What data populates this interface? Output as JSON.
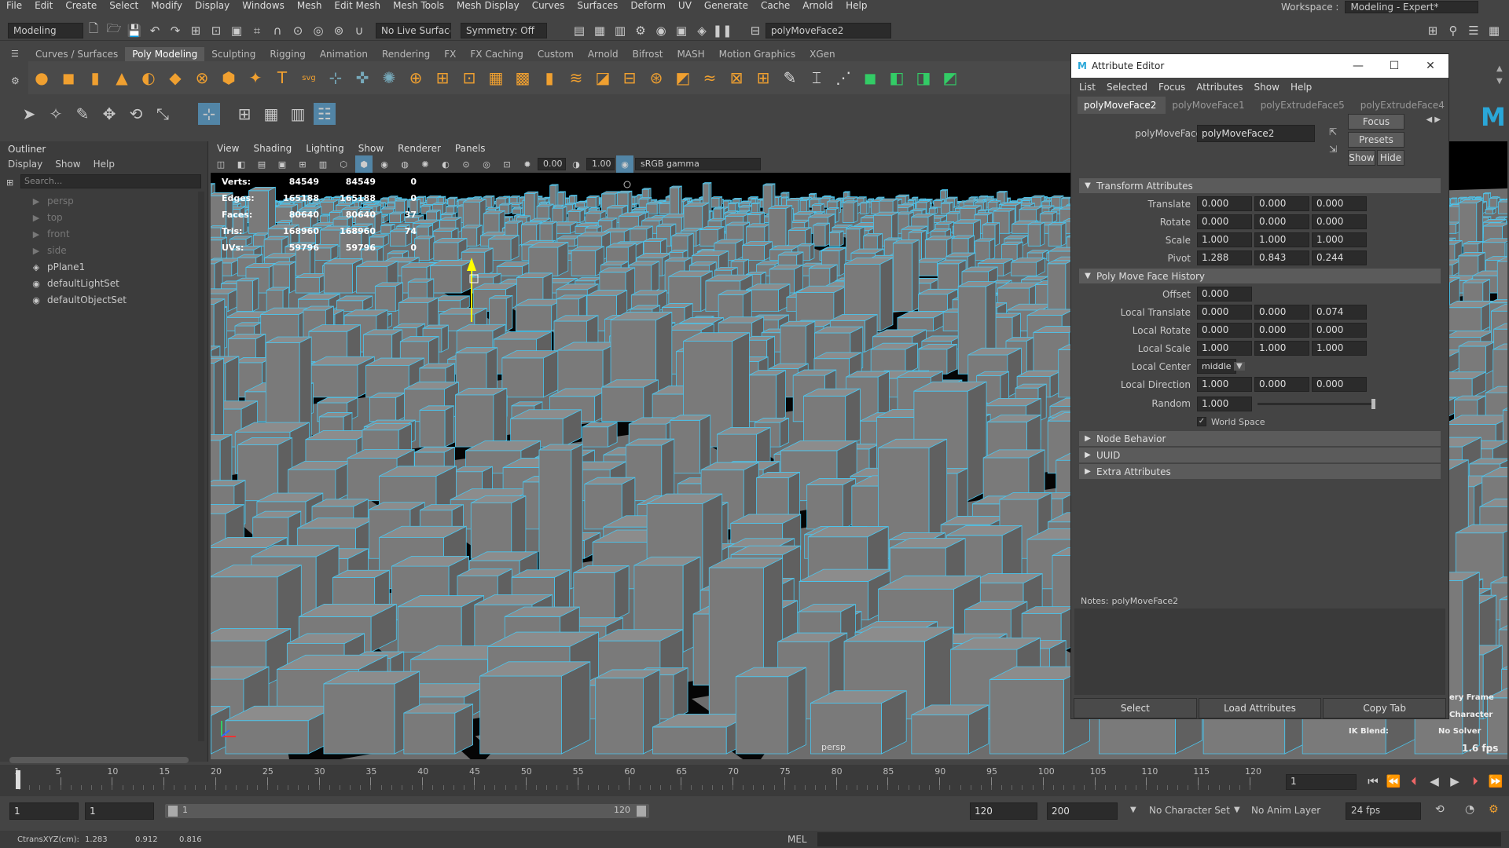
{
  "menubar": {
    "items": [
      "File",
      "Edit",
      "Create",
      "Select",
      "Modify",
      "Display",
      "Windows",
      "Mesh",
      "Edit Mesh",
      "Mesh Tools",
      "Mesh Display",
      "Curves",
      "Surfaces",
      "Deform",
      "UV",
      "Generate",
      "Cache",
      "Arnold",
      "Help"
    ],
    "workspace_label": "Workspace :",
    "workspace_value": "Modeling - Expert*"
  },
  "statusline": {
    "mode": "Modeling",
    "live_surface": "No Live Surface",
    "symmetry": "Symmetry: Off",
    "object_name": "polyMoveFace2"
  },
  "shelf_tabs": [
    "Curves / Surfaces",
    "Poly Modeling",
    "Sculpting",
    "Rigging",
    "Animation",
    "Rendering",
    "FX",
    "FX Caching",
    "Custom",
    "Arnold",
    "Bifrost",
    "MASH",
    "Motion Graphics",
    "XGen"
  ],
  "shelf_active": "Poly Modeling",
  "outliner": {
    "title": "Outliner",
    "menu": [
      "Display",
      "Show",
      "Help"
    ],
    "search_placeholder": "Search...",
    "items": [
      {
        "name": "persp",
        "icon": "camera-icon",
        "dim": true
      },
      {
        "name": "top",
        "icon": "camera-icon",
        "dim": true
      },
      {
        "name": "front",
        "icon": "camera-icon",
        "dim": true
      },
      {
        "name": "side",
        "icon": "camera-icon",
        "dim": true
      },
      {
        "name": "pPlane1",
        "icon": "mesh-icon",
        "dim": false
      },
      {
        "name": "defaultLightSet",
        "icon": "set-icon",
        "dim": false
      },
      {
        "name": "defaultObjectSet",
        "icon": "set-icon",
        "dim": false
      }
    ]
  },
  "viewport": {
    "menu": [
      "View",
      "Shading",
      "Lighting",
      "Show",
      "Renderer",
      "Panels"
    ],
    "exposure": "0.00",
    "gamma": "1.00",
    "colorspace": "sRGB gamma",
    "camera_label": "persp",
    "fps": "1.6 fps",
    "hud": [
      {
        "label": "Verts:",
        "a": "84549",
        "b": "84549",
        "c": "0"
      },
      {
        "label": "Edges:",
        "a": "165188",
        "b": "165188",
        "c": "0"
      },
      {
        "label": "Faces:",
        "a": "80640",
        "b": "80640",
        "c": "37"
      },
      {
        "label": "Tris:",
        "a": "168960",
        "b": "168960",
        "c": "74"
      },
      {
        "label": "UVs:",
        "a": "59796",
        "b": "59796",
        "c": "0"
      }
    ],
    "right_hud": {
      "line1": "ery Frame",
      "line2": "Character",
      "ik_label": "IK Blend:",
      "ik_value": "No Solver"
    }
  },
  "attr_editor": {
    "title": "Attribute Editor",
    "menu": [
      "List",
      "Selected",
      "Focus",
      "Attributes",
      "Show",
      "Help"
    ],
    "tabs": [
      "polyMoveFace2",
      "polyMoveFace1",
      "polyExtrudeFace5",
      "polyExtrudeFace4"
    ],
    "node_label": "polyMoveFace:",
    "node_value": "polyMoveFace2",
    "focus_btn": "Focus",
    "presets_btn": "Presets",
    "show_btn": "Show",
    "hide_btn": "Hide",
    "transform": {
      "header": "Transform Attributes",
      "rows": [
        {
          "label": "Translate",
          "v": [
            "0.000",
            "0.000",
            "0.000"
          ]
        },
        {
          "label": "Rotate",
          "v": [
            "0.000",
            "0.000",
            "0.000"
          ]
        },
        {
          "label": "Scale",
          "v": [
            "1.000",
            "1.000",
            "1.000"
          ]
        },
        {
          "label": "Pivot",
          "v": [
            "1.288",
            "0.843",
            "0.244"
          ]
        }
      ]
    },
    "history": {
      "header": "Poly Move Face History",
      "offset_label": "Offset",
      "offset": "0.000",
      "rows": [
        {
          "label": "Local Translate",
          "v": [
            "0.000",
            "0.000",
            "0.074"
          ]
        },
        {
          "label": "Local Rotate",
          "v": [
            "0.000",
            "0.000",
            "0.000"
          ]
        },
        {
          "label": "Local Scale",
          "v": [
            "1.000",
            "1.000",
            "1.000"
          ]
        }
      ],
      "center_label": "Local Center",
      "center_value": "middle",
      "direction_label": "Local Direction",
      "direction": [
        "1.000",
        "0.000",
        "0.000"
      ],
      "random_label": "Random",
      "random": "1.000",
      "world_space": "World Space"
    },
    "collapsed": [
      "Node Behavior",
      "UUID",
      "Extra Attributes"
    ],
    "notes_label": "Notes:",
    "notes_value": "polyMoveFace2",
    "buttons": [
      "Select",
      "Load Attributes",
      "Copy Tab"
    ]
  },
  "timeline": {
    "ticks": [
      "1",
      "5",
      "10",
      "15",
      "20",
      "25",
      "30",
      "35",
      "40",
      "45",
      "50",
      "55",
      "60",
      "65",
      "70",
      "75",
      "80",
      "85",
      "90",
      "95",
      "100",
      "105",
      "110",
      "115",
      "120"
    ],
    "current": "1"
  },
  "range": {
    "start": "1",
    "playstart": "1",
    "slider_start": "1",
    "slider_end": "120",
    "playend": "120",
    "end": "200",
    "char_set": "No Character Set",
    "anim_layer": "No Anim Layer",
    "fps": "24 fps"
  },
  "cmd": {
    "coords_label": "CtransXYZ(cm):",
    "x": "1.283",
    "y": "0.912",
    "z": "0.816",
    "lang": "MEL"
  }
}
